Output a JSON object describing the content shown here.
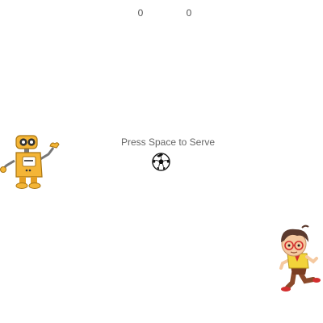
{
  "scoreboard": {
    "left_score": "0",
    "right_score": "0"
  },
  "message": "Press Space to Serve",
  "ball": {
    "icon": "soccer-ball-icon"
  },
  "players": {
    "left": {
      "icon": "robot-icon",
      "color": "#f4b536"
    },
    "right": {
      "icon": "boy-icon",
      "shirt_color": "#f2d33a"
    }
  }
}
